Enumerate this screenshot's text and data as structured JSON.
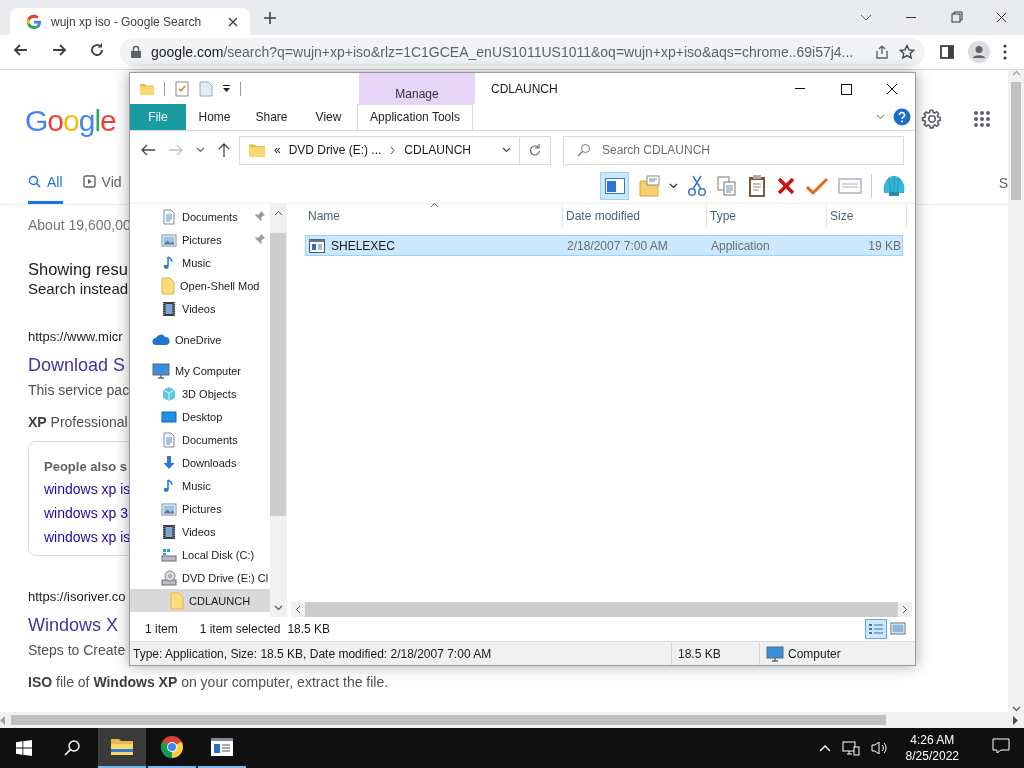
{
  "browser": {
    "tab": {
      "title": "wujn xp iso - Google Search"
    },
    "url": {
      "host": "google.com",
      "path": "/search?q=wujn+xp+iso&rlz=1C1GCEA_enUS1011US1011&oq=wujn+xp+iso&aqs=chrome..69i57j4..."
    }
  },
  "google": {
    "logo": "Google",
    "tabs": [
      {
        "label": "All",
        "kind": "all",
        "selected": true
      },
      {
        "label": "Vid",
        "kind": "videos",
        "selected": false
      }
    ],
    "right_tab": "S",
    "results_count": "About 19,600,00",
    "showing": "Showing resu",
    "search_instead": "Search instead",
    "results": [
      {
        "kind": "result",
        "url": "https://www.micr",
        "title": "Download S",
        "snippet": [
          "This service pac",
          "**XP** Professional"
        ]
      },
      {
        "kind": "people_also_search",
        "heading": "People also s",
        "links": [
          "windows xp is",
          "windows xp 3",
          "windows xp is"
        ]
      },
      {
        "kind": "result",
        "url": "https://isoriver.co",
        "title": "Windows X",
        "snippet": [
          "Steps to Create",
          "**ISO** file of **Windows XP** on your computer, extract the file."
        ]
      }
    ]
  },
  "explorer": {
    "title": "CDLAUNCH",
    "context_tab": "Manage",
    "ribbon_tabs": [
      {
        "label": "File",
        "kind": "file"
      },
      {
        "label": "Home",
        "kind": "plain"
      },
      {
        "label": "Share",
        "kind": "plain"
      },
      {
        "label": "View",
        "kind": "plain"
      },
      {
        "label": "Application Tools",
        "kind": "context"
      }
    ],
    "address": {
      "overflow": "«",
      "segments": [
        "DVD Drive (E:) ...",
        "CDLAUNCH"
      ]
    },
    "search": {
      "placeholder": "Search CDLAUNCH"
    },
    "toolbar": {
      "preview_pane_on": true
    },
    "quick_access": [
      {
        "label": "Documents",
        "kind": "documents",
        "pinned": true,
        "selected": false
      },
      {
        "label": "Pictures",
        "kind": "pictures",
        "pinned": true,
        "selected": false
      },
      {
        "label": "Music",
        "kind": "music",
        "pinned": false,
        "selected": false
      },
      {
        "label": "Open-Shell Mod",
        "kind": "folder",
        "pinned": false,
        "selected": false
      },
      {
        "label": "Videos",
        "kind": "videos",
        "pinned": false,
        "selected": false
      }
    ],
    "tree": [
      {
        "label": "OneDrive",
        "kind": "onedrive",
        "selected": false
      },
      {
        "label": "My Computer",
        "kind": "computer",
        "selected": false,
        "children": [
          {
            "label": "3D Objects",
            "kind": "objects3d",
            "selected": false
          },
          {
            "label": "Desktop",
            "kind": "desktop",
            "selected": false
          },
          {
            "label": "Documents",
            "kind": "documents",
            "selected": false
          },
          {
            "label": "Downloads",
            "kind": "downloads",
            "selected": false
          },
          {
            "label": "Music",
            "kind": "music",
            "selected": false
          },
          {
            "label": "Pictures",
            "kind": "pictures",
            "selected": false
          },
          {
            "label": "Videos",
            "kind": "videos",
            "selected": false
          },
          {
            "label": "Local Disk (C:)",
            "kind": "disk",
            "selected": false
          },
          {
            "label": "DVD Drive (E:) Cl",
            "kind": "dvd",
            "selected": false,
            "children": [
              {
                "label": "CDLAUNCH",
                "kind": "folder",
                "selected": true
              }
            ]
          }
        ]
      }
    ],
    "columns": [
      {
        "label": "Name",
        "sorted": true
      },
      {
        "label": "Date modified",
        "sorted": false
      },
      {
        "label": "Type",
        "sorted": false
      },
      {
        "label": "Size",
        "sorted": false
      }
    ],
    "files": [
      {
        "name": "SHELEXEC",
        "date_modified": "2/18/2007 7:00 AM",
        "type": "Application",
        "size": "19 KB",
        "selected": true
      }
    ],
    "status": {
      "count": "1 item",
      "selection": "1 item selected",
      "selection_size": "18.5 KB",
      "view_modes": [
        {
          "kind": "details",
          "selected": true
        },
        {
          "kind": "large-icons",
          "selected": false
        }
      ]
    },
    "details_bar": {
      "info": "Type: Application, Size: 18.5 KB, Date modified: 2/18/2007 7:00 AM",
      "size": "18.5 KB",
      "location": "Computer"
    }
  },
  "taskbar": {
    "apps": [
      {
        "kind": "explorer",
        "active": true
      },
      {
        "kind": "chrome",
        "active": false
      },
      {
        "kind": "app",
        "active": false
      }
    ],
    "time": "4:26 AM",
    "date": "8/25/2022"
  }
}
